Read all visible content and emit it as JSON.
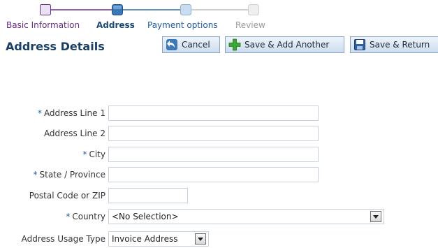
{
  "train": {
    "steps": [
      {
        "label": "Basic Information",
        "state": "visited"
      },
      {
        "label": "Address",
        "state": "current"
      },
      {
        "label": "Payment options",
        "state": "next"
      },
      {
        "label": "Review",
        "state": "disabled"
      }
    ]
  },
  "header": {
    "title": "Address Details"
  },
  "toolbar": {
    "cancel_label": "Cancel",
    "save_add_label": "Save & Add Another",
    "save_return_label": "Save & Return",
    "cancel_icon": "undo-arrow-icon",
    "save_add_icon": "green-plus-icon",
    "save_return_icon": "floppy-disk-icon"
  },
  "form": {
    "required_marker": "*",
    "address1": {
      "label": "Address Line 1",
      "value": "",
      "required": true
    },
    "address2": {
      "label": "Address Line 2",
      "value": "",
      "required": false
    },
    "city": {
      "label": "City",
      "value": "",
      "required": true
    },
    "state": {
      "label": "State / Province",
      "value": "",
      "required": true
    },
    "postal": {
      "label": "Postal Code or ZIP",
      "value": "",
      "required": false
    },
    "country": {
      "label": "Country",
      "value": "<No Selection>",
      "required": true
    },
    "usage": {
      "label": "Address Usage Type",
      "value": "Invoice Address",
      "required": false
    }
  },
  "colors": {
    "visited_step": "#6a2c87",
    "current_step": "#1a4a7a",
    "required_marker": "#1f5a9e",
    "title": "#1a3f66"
  }
}
